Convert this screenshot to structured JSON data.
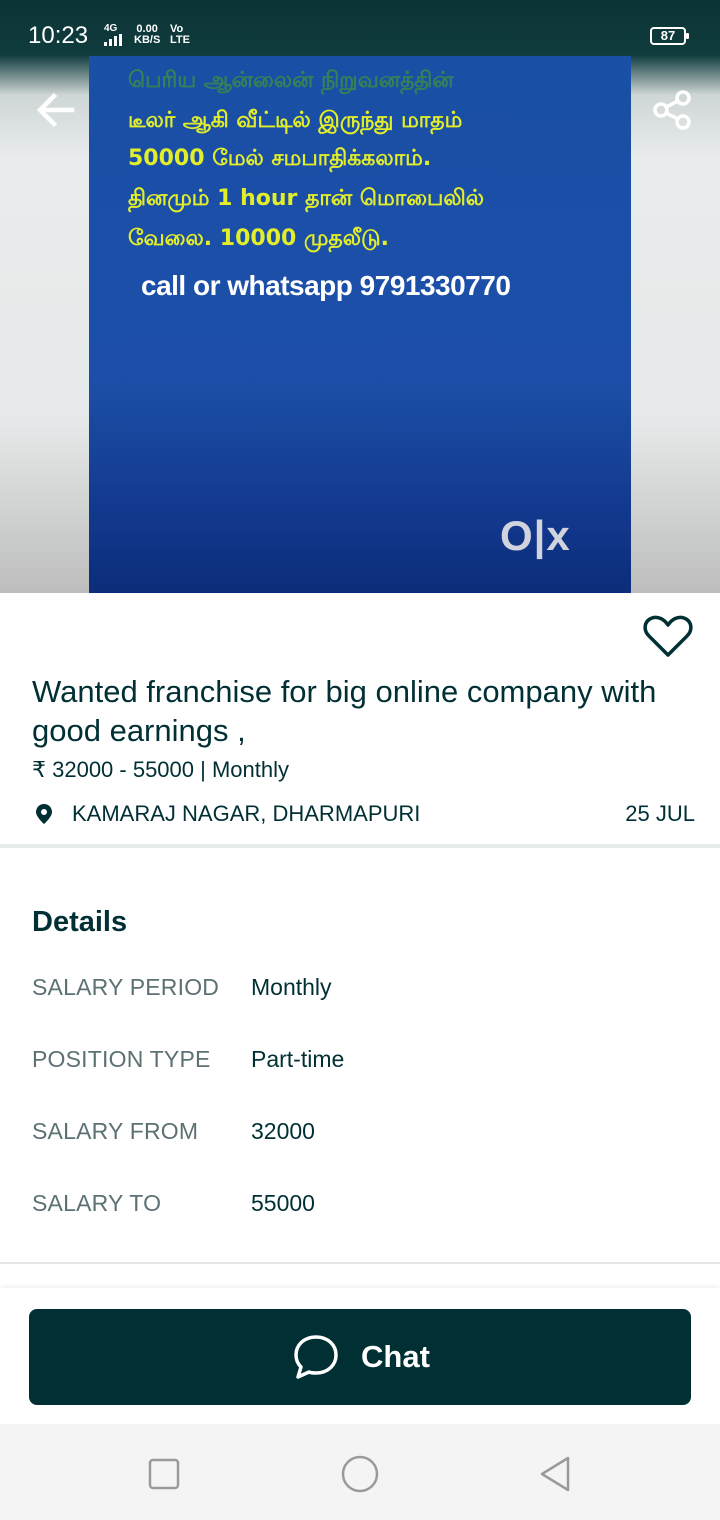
{
  "status_bar": {
    "time": "10:23",
    "signal": "4G",
    "speed_value": "0.00",
    "speed_unit": "KB/S",
    "volte_top": "Vo",
    "volte_bottom": "LTE",
    "battery": "87"
  },
  "hero": {
    "ad_lines": [
      "பெரிய ஆன்லைன் நிறுவனத்தின்",
      "டீலர் ஆகி வீட்டில் இருந்து மாதம்",
      "50000 மேல் சமபாதிக்கலாம்.",
      "தினமும் 1 hour தான் மொபைலில்",
      "வேலை. 10000 முதலீடு.",
      "call or whatsapp  9791330770"
    ],
    "watermark": "O|x"
  },
  "listing": {
    "title": "Wanted franchise for big online company with good earnings ,",
    "price": "₹ 32000 - 55000 | Monthly",
    "location": "KAMARAJ NAGAR, DHARMAPURI",
    "date": "25 JUL"
  },
  "details": {
    "heading": "Details",
    "rows": [
      {
        "label": "SALARY PERIOD",
        "value": "Monthly"
      },
      {
        "label": "POSITION TYPE",
        "value": "Part-time"
      },
      {
        "label": "SALARY FROM",
        "value": "32000"
      },
      {
        "label": "SALARY TO",
        "value": "55000"
      }
    ]
  },
  "chat": {
    "label": "Chat"
  },
  "icons": {
    "back": "arrow-left-icon",
    "share": "share-icon",
    "favorite": "heart-outline-icon",
    "location": "location-pin-icon",
    "chat": "chat-bubble-icon"
  },
  "colors": {
    "primary": "#002f34",
    "label": "#5c7173",
    "ad_background": "#1d4fa8",
    "ad_text": "#e2ee2a"
  }
}
